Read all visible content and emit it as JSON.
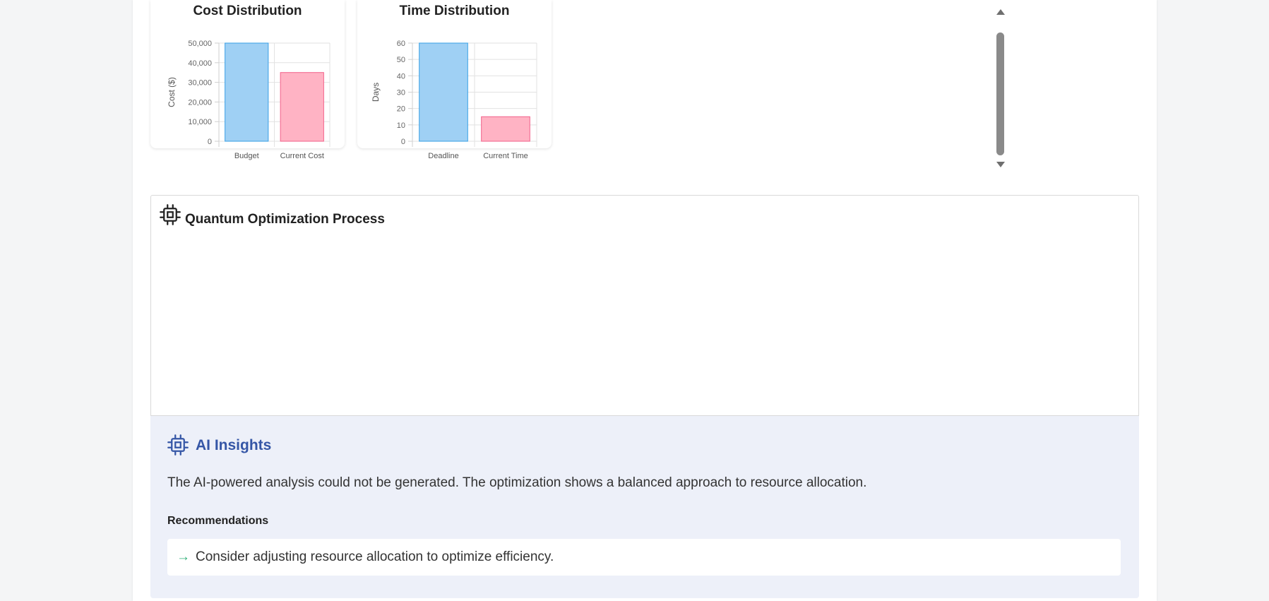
{
  "charts": [
    {
      "title": "Cost Distribution",
      "type": "bar",
      "categories": [
        "Budget",
        "Current Cost"
      ],
      "values": [
        50000,
        35000
      ],
      "ylabel": "Cost ($)",
      "ylim": [
        0,
        50000
      ],
      "yticks": [
        0,
        10000,
        20000,
        30000,
        40000,
        50000
      ],
      "tick_labels": [
        "0",
        "10,000",
        "20,000",
        "30,000",
        "40,000",
        "50,000"
      ],
      "colors": {
        "fill": [
          "#9fd0f4",
          "#ffb3c4"
        ],
        "stroke": [
          "#39a0e6",
          "#f2628a"
        ]
      }
    },
    {
      "title": "Time Distribution",
      "type": "bar",
      "categories": [
        "Deadline",
        "Current Time"
      ],
      "values": [
        60,
        15
      ],
      "ylabel": "Days",
      "ylim": [
        0,
        60
      ],
      "yticks": [
        0,
        10,
        20,
        30,
        40,
        50,
        60
      ],
      "tick_labels": [
        "0",
        "10",
        "20",
        "30",
        "40",
        "50",
        "60"
      ],
      "colors": {
        "fill": [
          "#9fd0f4",
          "#ffb3c4"
        ],
        "stroke": [
          "#39a0e6",
          "#f2628a"
        ]
      }
    }
  ],
  "quantum": {
    "title": "Quantum Optimization Process",
    "icon": "cpu-icon"
  },
  "insights": {
    "title": "AI Insights",
    "icon": "cpu-icon",
    "accent": "#3556a6",
    "text": "The AI-powered analysis could not be generated. The optimization shows a balanced approach to resource allocation.",
    "recommendations_heading": "Recommendations",
    "recommendations": [
      {
        "arrow": "→",
        "text": "Consider adjusting resource allocation to optimize efficiency."
      }
    ]
  }
}
